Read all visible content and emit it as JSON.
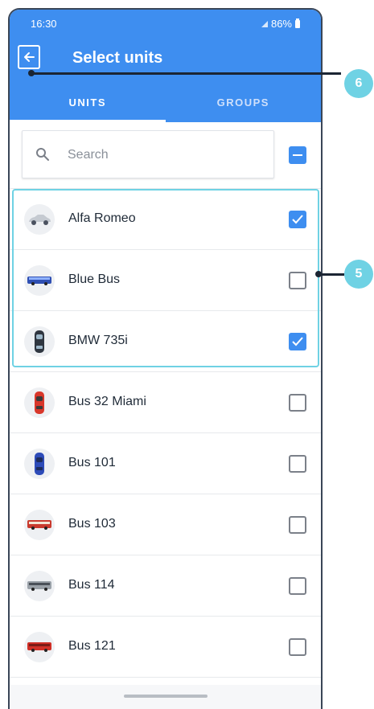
{
  "status_bar": {
    "time": "16:30",
    "battery": "86%"
  },
  "header": {
    "title": "Select units"
  },
  "tabs": [
    {
      "label": "UNITS",
      "active": true
    },
    {
      "label": "GROUPS",
      "active": false
    }
  ],
  "search": {
    "placeholder": "Search"
  },
  "units": [
    {
      "name": "Alfa Romeo",
      "checked": true,
      "icon": "silver-car-icon"
    },
    {
      "name": "Blue Bus",
      "checked": false,
      "icon": "blue-bus-icon"
    },
    {
      "name": "BMW 735i",
      "checked": true,
      "icon": "dark-car-icon"
    },
    {
      "name": "Bus 32 Miami",
      "checked": false,
      "icon": "red-car-icon"
    },
    {
      "name": "Bus 101",
      "checked": false,
      "icon": "blue-car-icon"
    },
    {
      "name": "Bus 103",
      "checked": false,
      "icon": "red-bus-icon"
    },
    {
      "name": "Bus 114",
      "checked": false,
      "icon": "grey-bus-icon"
    },
    {
      "name": "Bus 121",
      "checked": false,
      "icon": "red-bus-icon"
    }
  ],
  "callouts": {
    "back": "6",
    "selection": "5"
  },
  "colors": {
    "primary": "#3e8ef0",
    "callout": "#6fd2e4"
  }
}
